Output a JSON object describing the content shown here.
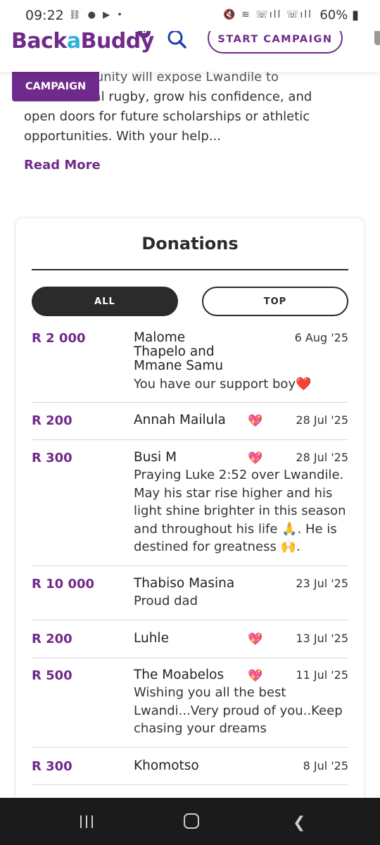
{
  "status": {
    "time": "09:22",
    "battery": "60%"
  },
  "header": {
    "logo_part1": "Back",
    "logo_part2": "a",
    "logo_part3": "Buddy",
    "start_label": "START CAMPAIGN"
  },
  "campaign_tag": "CAMPAIGN",
  "story": {
    "line1_visible": "This opportunity will expose Lwandile to",
    "line2_visible": "international rugby, grow his confidence, and",
    "line3": "open doors for future scholarships or athletic",
    "line4": "opportunities. With your help...",
    "read_more": "Read More"
  },
  "donations": {
    "title": "Donations",
    "tabs": {
      "all": "ALL",
      "top": "TOP"
    },
    "rows": [
      {
        "amount": "R 2 000",
        "name": "Malome\nThapelo and\nMmane Samu",
        "date": "6 Aug '25",
        "message": "You have our support boy❤️"
      },
      {
        "amount": "R 200",
        "name": "Annah Mailula",
        "date": "28 Jul '25",
        "message": ""
      },
      {
        "amount": "R 300",
        "name": "Busi M",
        "date": "28 Jul '25",
        "message": "Praying Luke 2:52 over Lwandile.\nMay his star rise higher and his\nlight shine brighter in this season\nand throughout his life 🙏. He is\ndestined for greatness 🙌."
      },
      {
        "amount": "R 10 000",
        "name": "Thabiso Masina",
        "date": "23 Jul '25",
        "message": "Proud dad"
      },
      {
        "amount": "R 200",
        "name": "Luhle",
        "date": "13 Jul '25",
        "message": ""
      },
      {
        "amount": "R 500",
        "name": "The Moabelos",
        "date": "11 Jul '25",
        "message": "Wishing you all the best\nLwandi...Very proud of you..Keep\nchasing your dreams"
      },
      {
        "amount": "R 300",
        "name": "Khomotso",
        "date": "8 Jul '25",
        "message": ""
      }
    ]
  }
}
